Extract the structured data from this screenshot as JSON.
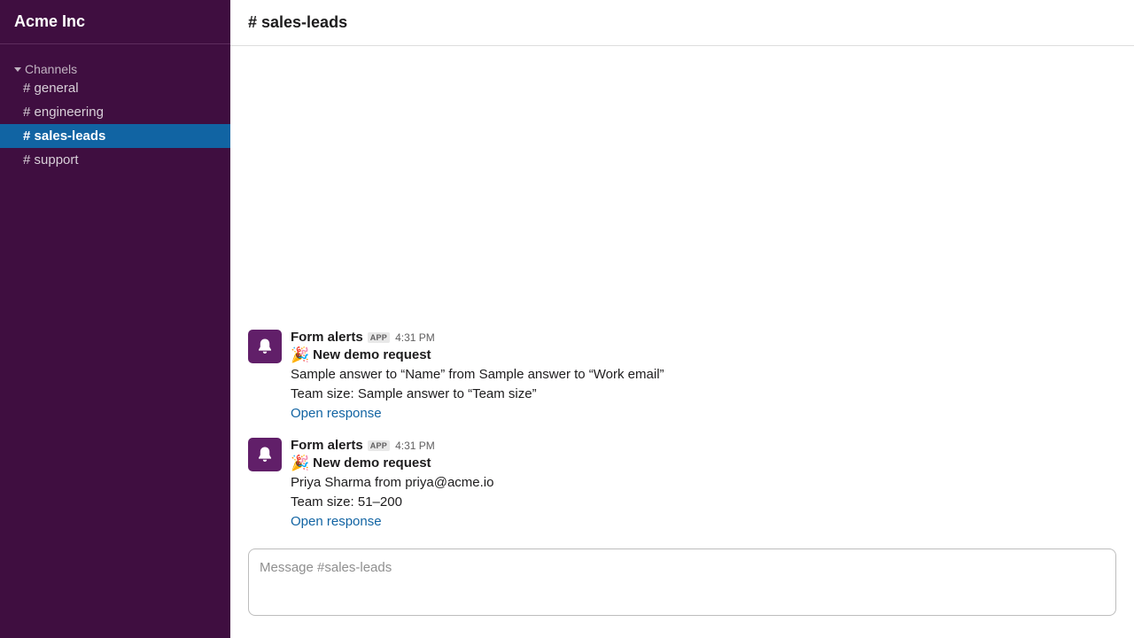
{
  "workspace": {
    "name": "Acme Inc"
  },
  "sidebar": {
    "section_label": "Channels",
    "channels": [
      {
        "label": "# general"
      },
      {
        "label": "# engineering"
      },
      {
        "label": "# sales-leads",
        "active": true
      },
      {
        "label": "# support"
      }
    ]
  },
  "channel": {
    "title": "# sales-leads"
  },
  "messages": [
    {
      "sender": "Form alerts",
      "badge": "APP",
      "time": "4:31 PM",
      "emoji": "🎉",
      "title": "New demo request",
      "line1": "Sample answer to “Name” from Sample answer to “Work email”",
      "line2": "Team size: Sample answer to “Team size”",
      "link": "Open response"
    },
    {
      "sender": "Form alerts",
      "badge": "APP",
      "time": "4:31 PM",
      "emoji": "🎉",
      "title": "New demo request",
      "line1": "Priya Sharma from priya@acme.io",
      "line2": "Team size: 51–200",
      "link": "Open response"
    }
  ],
  "composer": {
    "placeholder": "Message #sales-leads"
  },
  "colors": {
    "sidebar_bg": "#3f0e40",
    "active_channel": "#1164a3",
    "avatar_bg": "#611f69",
    "link": "#1264a3"
  },
  "icons": {
    "avatar": "bell-icon",
    "section_toggle": "caret-down-icon"
  }
}
